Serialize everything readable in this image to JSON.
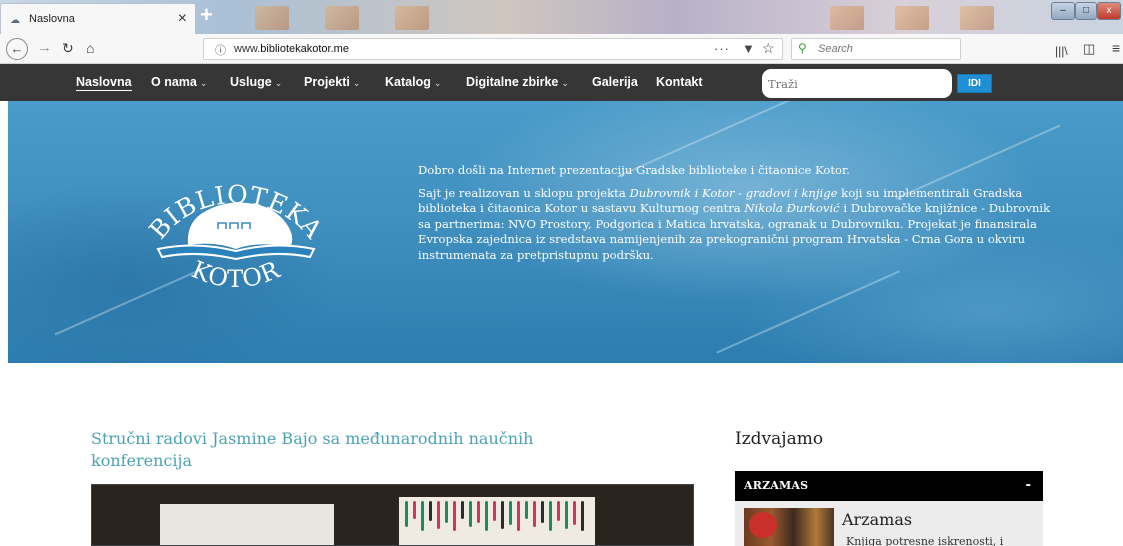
{
  "browser": {
    "tab_title": "Naslovna",
    "new_tab_symbol": "+",
    "url_prefix": "www.",
    "url_domain": "bibliotekakotor.me",
    "search_placeholder": "Search",
    "window_controls": {
      "minimize": "–",
      "maximize": "□",
      "close": "x"
    }
  },
  "site_nav": {
    "items": [
      {
        "label": "Naslovna",
        "dropdown": false,
        "active": true
      },
      {
        "label": "O nama",
        "dropdown": true
      },
      {
        "label": "Usluge",
        "dropdown": true
      },
      {
        "label": "Projekti",
        "dropdown": true
      },
      {
        "label": "Katalog",
        "dropdown": true
      },
      {
        "label": "Digitalne zbirke",
        "dropdown": true
      },
      {
        "label": "Galerija",
        "dropdown": false
      },
      {
        "label": "Kontakt",
        "dropdown": false
      }
    ],
    "search_placeholder": "Traži",
    "search_button": "IDI"
  },
  "logo": {
    "top_text": "BIBLIOTEKA",
    "bottom_text": "KOTOR"
  },
  "hero": {
    "p1": "Dobro došli na Internet prezentaciju Gradske biblioteke i čitaonice Kotor.",
    "p2_a": "Sajt je realizovan u sklopu projekta ",
    "p2_project": "Dubrovnik i Kotor - gradovi i knjige",
    "p2_b": " koji su implementirali Gradska biblioteka i čitaonica Kotor u sastavu Kulturnog centra ",
    "p2_center": "Nikola Đurković",
    "p2_c": " i Dubrovačke knjižnice - Dubrovnik sa partnerima: NVO Prostory, Podgorica i Matica hrvatska, ogranak u Dubrovniku. Projekat je finansirala Evropska zajednica iz sredstava namijenjenih za prekogranični program Hrvatska - Crna Gora u okviru instrumenata za pretpristupnu podršku."
  },
  "article": {
    "title": "Stručni radovi Jasmine Bajo sa međunarodnih naučnih konferencija"
  },
  "sidebar": {
    "heading": "Izdvajamo",
    "widget_title": "ARZAMAS",
    "widget_toggle": "-",
    "item_title": "Arzamas",
    "item_text": "Knjiga potresne iskrenosti, i"
  },
  "colors": {
    "nav_bg": "#363636",
    "accent_teal": "#4aa2b4",
    "button_blue": "#1f8fd6",
    "hero_blue": "#3f8fbf"
  }
}
